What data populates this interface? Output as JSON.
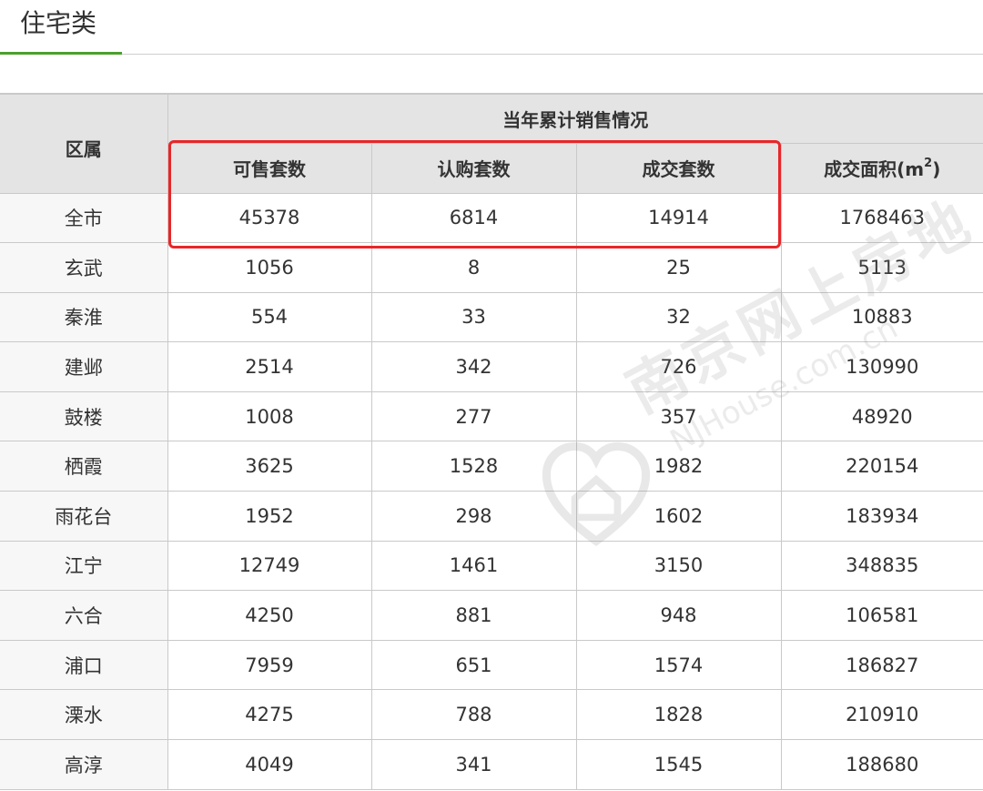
{
  "tab": {
    "label": "住宅类"
  },
  "table": {
    "district_header": "区属",
    "group_header": "当年累计销售情况",
    "columns": [
      "可售套数",
      "认购套数",
      "成交套数",
      "成交面积(m",
      "2",
      ")"
    ],
    "rows": [
      {
        "district": "全市",
        "available": "45378",
        "subscribed": "6814",
        "sold": "14914",
        "area": "1768463"
      },
      {
        "district": "玄武",
        "available": "1056",
        "subscribed": "8",
        "sold": "25",
        "area": "5113"
      },
      {
        "district": "秦淮",
        "available": "554",
        "subscribed": "33",
        "sold": "32",
        "area": "10883"
      },
      {
        "district": "建邺",
        "available": "2514",
        "subscribed": "342",
        "sold": "726",
        "area": "130990"
      },
      {
        "district": "鼓楼",
        "available": "1008",
        "subscribed": "277",
        "sold": "357",
        "area": "48920"
      },
      {
        "district": "栖霞",
        "available": "3625",
        "subscribed": "1528",
        "sold": "1982",
        "area": "220154"
      },
      {
        "district": "雨花台",
        "available": "1952",
        "subscribed": "298",
        "sold": "1602",
        "area": "183934"
      },
      {
        "district": "江宁",
        "available": "12749",
        "subscribed": "1461",
        "sold": "3150",
        "area": "348835"
      },
      {
        "district": "六合",
        "available": "4250",
        "subscribed": "881",
        "sold": "948",
        "area": "106581"
      },
      {
        "district": "浦口",
        "available": "7959",
        "subscribed": "651",
        "sold": "1574",
        "area": "186827"
      },
      {
        "district": "溧水",
        "available": "4275",
        "subscribed": "788",
        "sold": "1828",
        "area": "210910"
      },
      {
        "district": "高淳",
        "available": "4049",
        "subscribed": "341",
        "sold": "1545",
        "area": "188680"
      }
    ]
  },
  "watermark": {
    "name": "南京网上房地",
    "domain": "NJHouse.com.cn"
  },
  "colors": {
    "tab_underline": "#4aa02c",
    "highlight_border": "#e8262a",
    "header_bg": "#e4e4e4"
  }
}
